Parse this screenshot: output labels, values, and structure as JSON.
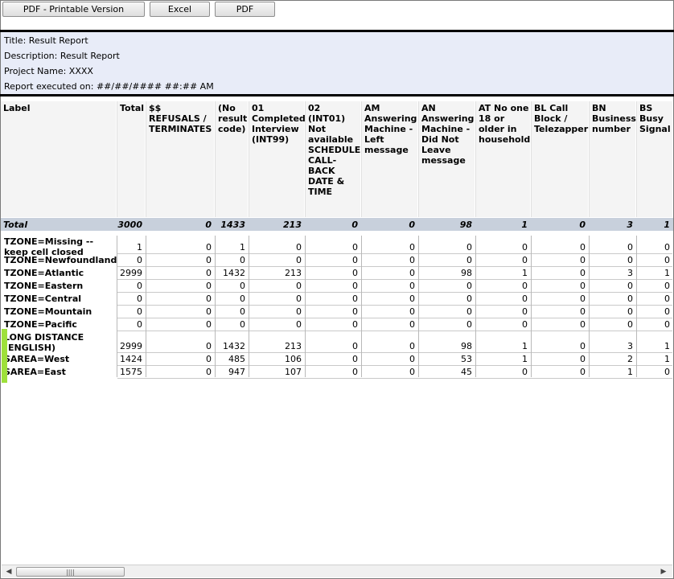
{
  "toolbar": {
    "pdf_printable_label": "PDF - Printable Version",
    "excel_label": "Excel",
    "pdf_label": "PDF"
  },
  "header": {
    "title": "Title: Result Report",
    "description": "Description: Result Report",
    "project": "Project Name: XXXX",
    "executed": "Report executed on: ##/##/#### ##:## AM"
  },
  "table": {
    "columns": [
      "Label",
      "Total",
      "$$ REFUSALS / TERMINATES",
      "(No result code)",
      "01 Completed Interview (INT99)",
      "02 (INT01) Not available SCHEDULE CALL-BACK DATE & TIME",
      "AM Answering Machine - Left message",
      "AN Answering Machine - Did Not Leave message",
      "AT No one 18 or older in household",
      "BL Call Block / Telezapper",
      "BN Business number",
      "BS Busy Signal"
    ],
    "total_row": {
      "label": "Total",
      "values": [
        "3000",
        "0",
        "1433",
        "213",
        "0",
        "0",
        "98",
        "1",
        "0",
        "3",
        "1"
      ]
    },
    "rows": [
      {
        "label": "TZONE=Missing -- keep cell closed",
        "values": [
          "1",
          "0",
          "1",
          "0",
          "0",
          "0",
          "0",
          "0",
          "0",
          "0",
          "0"
        ]
      },
      {
        "label": "TZONE=Newfoundland",
        "values": [
          "0",
          "0",
          "0",
          "0",
          "0",
          "0",
          "0",
          "0",
          "0",
          "0",
          "0"
        ]
      },
      {
        "label": "TZONE=Atlantic",
        "values": [
          "2999",
          "0",
          "1432",
          "213",
          "0",
          "0",
          "98",
          "1",
          "0",
          "3",
          "1"
        ]
      },
      {
        "label": "TZONE=Eastern",
        "values": [
          "0",
          "0",
          "0",
          "0",
          "0",
          "0",
          "0",
          "0",
          "0",
          "0",
          "0"
        ]
      },
      {
        "label": "TZONE=Central",
        "values": [
          "0",
          "0",
          "0",
          "0",
          "0",
          "0",
          "0",
          "0",
          "0",
          "0",
          "0"
        ]
      },
      {
        "label": "TZONE=Mountain",
        "values": [
          "0",
          "0",
          "0",
          "0",
          "0",
          "0",
          "0",
          "0",
          "0",
          "0",
          "0"
        ]
      },
      {
        "label": "TZONE=Pacific",
        "values": [
          "0",
          "0",
          "0",
          "0",
          "0",
          "0",
          "0",
          "0",
          "0",
          "0",
          "0"
        ]
      },
      {
        "label": "LONG DISTANCE (ENGLISH)",
        "values": [
          "2999",
          "0",
          "1432",
          "213",
          "0",
          "0",
          "98",
          "1",
          "0",
          "3",
          "1"
        ]
      },
      {
        "label": "SAREA=West",
        "values": [
          "1424",
          "0",
          "485",
          "106",
          "0",
          "0",
          "53",
          "1",
          "0",
          "2",
          "1"
        ]
      },
      {
        "label": "SAREA=East",
        "values": [
          "1575",
          "0",
          "947",
          "107",
          "0",
          "0",
          "45",
          "0",
          "0",
          "1",
          "0"
        ]
      }
    ]
  },
  "scrollbar": {
    "left_arrow_icon": "arrow-left-icon",
    "right_arrow_icon": "arrow-right-icon",
    "thumb_grip": "||||"
  }
}
